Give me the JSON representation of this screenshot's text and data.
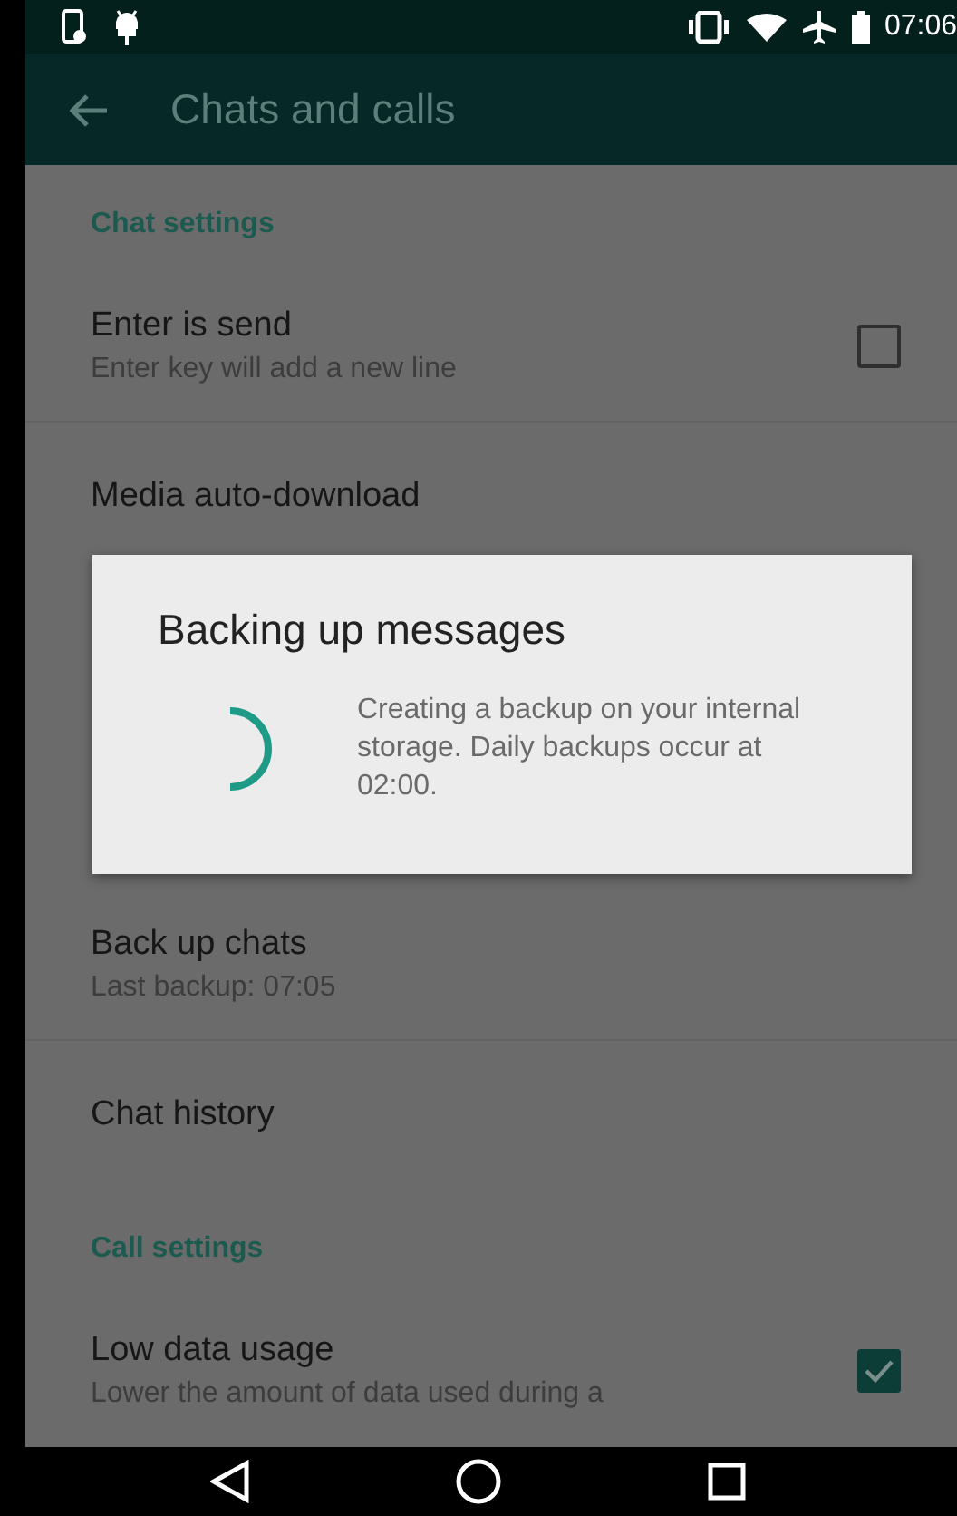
{
  "status_bar": {
    "time": "07:06"
  },
  "app_bar": {
    "title": "Chats and calls"
  },
  "settings": [
    {
      "kind": "section",
      "title": "Chat settings"
    },
    {
      "kind": "checkbox",
      "title": "Enter is send",
      "subtitle": "Enter key will add a new line",
      "checked": false
    },
    {
      "kind": "item",
      "title": "Media auto-download"
    },
    {
      "kind": "hidden"
    },
    {
      "kind": "item",
      "title": "Back up chats",
      "subtitle": "Last backup: 07:05"
    },
    {
      "kind": "item",
      "title": "Chat history"
    },
    {
      "kind": "section",
      "title": "Call settings"
    },
    {
      "kind": "checkbox",
      "title": "Low data usage",
      "subtitle": "Lower the amount of data used during a",
      "checked": true
    }
  ],
  "dialog": {
    "title": "Backing up messages",
    "message": "Creating a backup on your internal storage. Daily backups occur at 02:00."
  }
}
